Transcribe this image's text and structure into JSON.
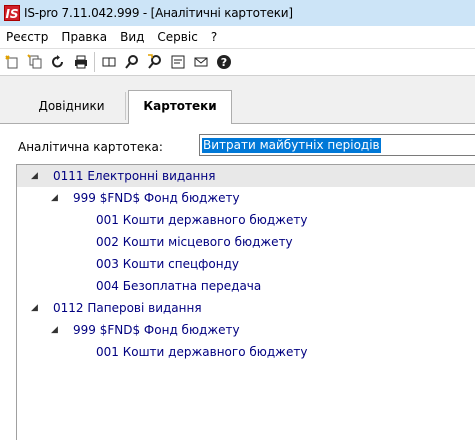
{
  "window": {
    "app_icon_text": "IS",
    "title": "IS-pro 7.11.042.999 - [Аналітичні картотеки]"
  },
  "menu": [
    "Реєстр",
    "Правка",
    "Вид",
    "Сервіс",
    "?"
  ],
  "toolbar_icons": [
    "new-record-icon",
    "copy-record-icon",
    "refresh-icon",
    "print-icon",
    "columns-icon",
    "find-icon",
    "find-next-icon",
    "form-icon",
    "mail-icon",
    "help-icon"
  ],
  "tabs": [
    {
      "label": "Довідники",
      "active": false
    },
    {
      "label": "Картотеки",
      "active": true
    }
  ],
  "field": {
    "label": "Аналітична картотека:",
    "value": "Витрати майбутніх періодів"
  },
  "tree": [
    {
      "text": "0111 Електронні видання",
      "level": 0,
      "expanded": true,
      "selected": true
    },
    {
      "text": "999 $FND$ Фонд бюджету",
      "level": 1,
      "expanded": true
    },
    {
      "text": "001 Кошти державного бюджету",
      "level": 2
    },
    {
      "text": "002 Кошти місцевого бюджету",
      "level": 2
    },
    {
      "text": "003 Кошти спецфонду",
      "level": 2
    },
    {
      "text": "004 Безоплатна передача",
      "level": 2
    },
    {
      "text": "0112 Паперові видання",
      "level": 0,
      "expanded": true
    },
    {
      "text": "999 $FND$ Фонд бюджету",
      "level": 1,
      "expanded": true
    },
    {
      "text": "001 Кошти державного бюджету",
      "level": 2
    }
  ],
  "colors": {
    "tree_text": "#000080",
    "selection": "#0078d7",
    "titlebar": "#cce4f7"
  }
}
